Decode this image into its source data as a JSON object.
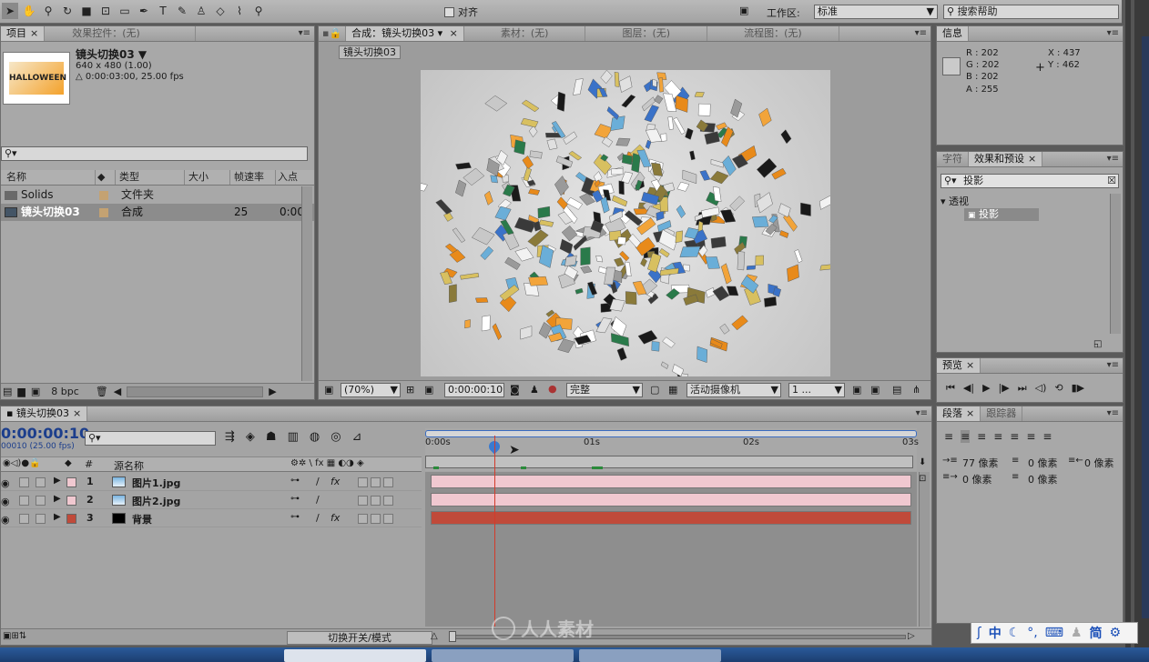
{
  "toolbar": {
    "snap_label": "对齐",
    "workspace_label": "工作区:",
    "workspace_value": "标准",
    "search_help_placeholder": "搜索帮助"
  },
  "project_panel": {
    "tabs": [
      "项目",
      "效果控件：(无)"
    ],
    "item_name": "镜头切换03 ▼",
    "item_size": "640 x 480 (1.00)",
    "item_duration": "△ 0:00:03:00, 25.00 fps",
    "thumb_text": "HALLOWEEN",
    "columns": [
      "名称",
      "类型",
      "大小",
      "帧速率",
      "入点"
    ],
    "rows": [
      {
        "name": "Solids",
        "type": "文件夹",
        "fps": "",
        "inpoint": ""
      },
      {
        "name": "镜头切换03",
        "type": "合成",
        "fps": "25",
        "inpoint": "0:00"
      }
    ],
    "bpc": "8 bpc"
  },
  "comp_panel": {
    "tabs": [
      "合成：镜头切换03",
      "素材：(无)",
      "图层：(无)",
      "流程图：(无)"
    ],
    "comp_tab_button": "镜头切换03",
    "zoom": "(70%)",
    "timecode": "0:00:00:10",
    "resolution": "完整",
    "camera": "活动摄像机",
    "views": "1 ..."
  },
  "info_panel": {
    "title": "信息",
    "r": "R : 202",
    "g": "G : 202",
    "b": "B : 202",
    "a": "A : 255",
    "x": "X : 437",
    "y": "Y : 462"
  },
  "effects_panel": {
    "tabs": [
      "字符",
      "效果和预设"
    ],
    "search_value": "投影",
    "category": "透视",
    "item": "投影"
  },
  "preview_panel": {
    "title": "预览"
  },
  "paragraph_panel": {
    "tabs": [
      "段落",
      "跟踪器"
    ],
    "indent_left": "77 像素",
    "indent_right": "0 像素",
    "indent_first": "0 像素",
    "space_before": "0 像素",
    "space_after": "0 像素",
    "space_extra": "0 像素"
  },
  "timeline": {
    "tab": "镜头切换03",
    "timecode": "0:00:00:10",
    "frame_info": "00010 (25.00 fps)",
    "col_number": "#",
    "col_source": "源名称",
    "ruler": [
      "0:00s",
      "01s",
      "02s",
      "03s"
    ],
    "layers": [
      {
        "num": "1",
        "name": "图片1.jpg",
        "color": "#f0c8d0"
      },
      {
        "num": "2",
        "name": "图片2.jpg",
        "color": "#f0c8d0"
      },
      {
        "num": "3",
        "name": "背景",
        "color": "#c04a3a"
      }
    ],
    "switch_mode": "切换开关/模式"
  },
  "watermark": "人人素材",
  "ime": {
    "lang": "中",
    "simplified": "简"
  }
}
